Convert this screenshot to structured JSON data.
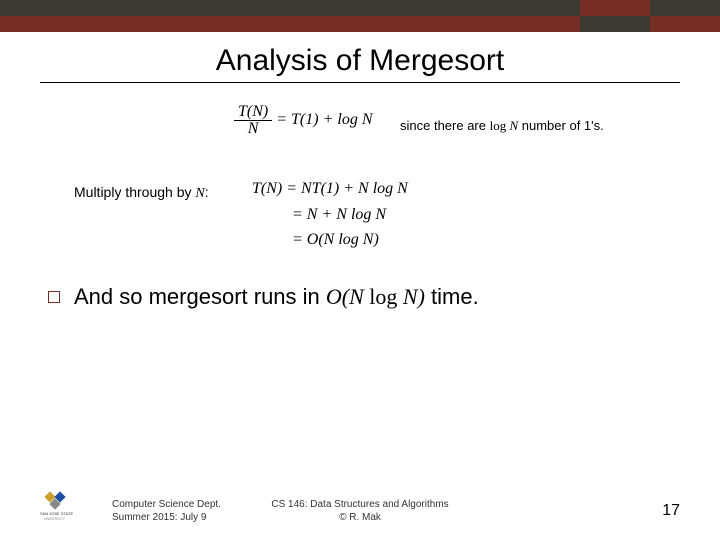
{
  "title": "Analysis of Mergesort",
  "since_note_prefix": "since there are ",
  "since_note_math": "log N",
  "since_note_suffix": " number of 1's.",
  "eq1_lhs_num": "T(N)",
  "eq1_lhs_den": "N",
  "eq1_rhs": " = T(1) + log N",
  "multiply_prefix": "Multiply through by ",
  "multiply_var": "N",
  "multiply_suffix": ":",
  "eq2_line1": "T(N) = NT(1) + N log N",
  "eq2_line2": "= N + N log N",
  "eq2_line3": "= O(N log N)",
  "bullet_prefix": "And so mergesort runs in ",
  "bullet_math_italic": "O(N ",
  "bullet_math_rm": "log ",
  "bullet_math_italic2": "N)",
  "bullet_suffix": " time.",
  "footer_left_l1": "Computer Science Dept.",
  "footer_left_l2": "Summer 2015: July 9",
  "footer_center_l1": "CS 146: Data Structures and Algorithms",
  "footer_center_l2": "© R. Mak",
  "slide_number": "17"
}
